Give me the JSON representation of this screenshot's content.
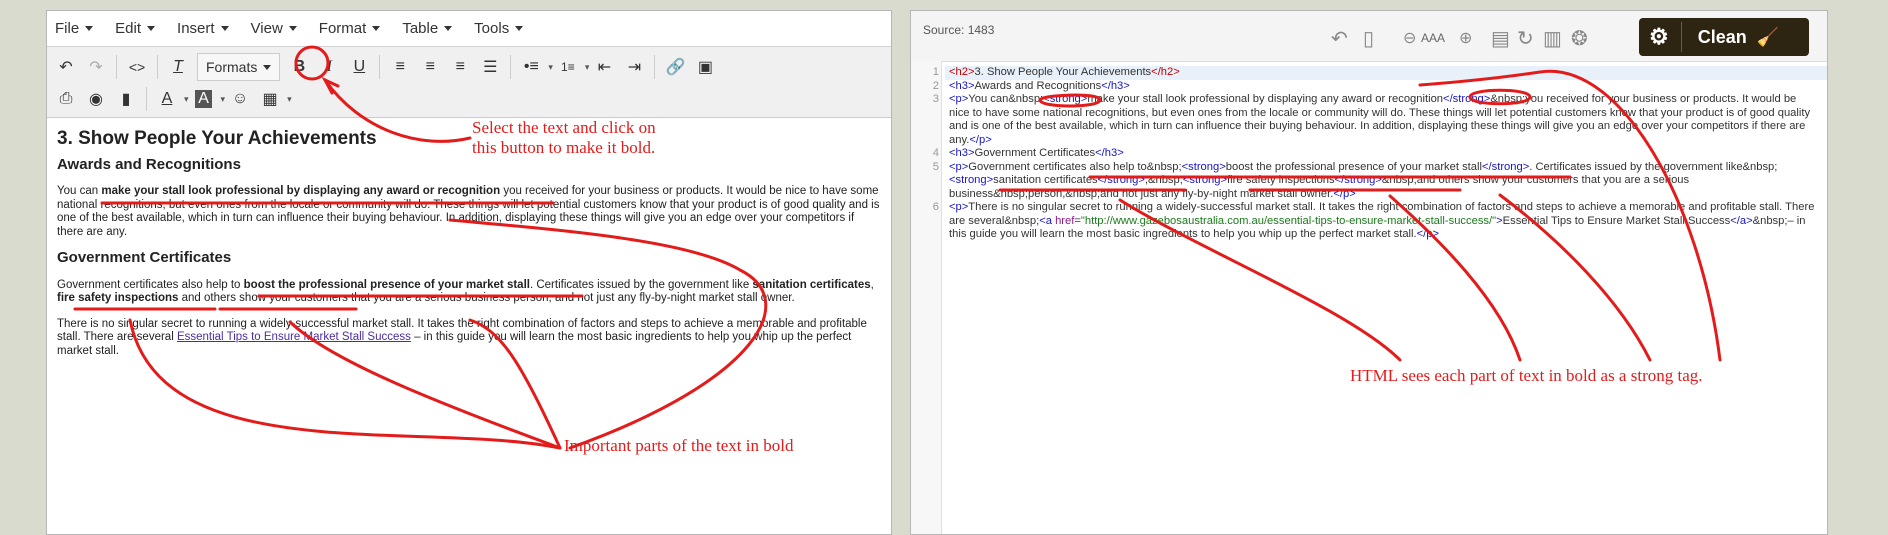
{
  "menubar": [
    "File",
    "Edit",
    "Insert",
    "View",
    "Format",
    "Table",
    "Tools"
  ],
  "toolbar": {
    "formats_label": "Formats"
  },
  "editor_content": {
    "h2": "3. Show People Your Achievements",
    "h3_awards": "Awards and Recognitions",
    "p1_pre": "You can ",
    "p1_bold": "make your stall look professional by displaying any award or recognition",
    "p1_post": " you received for your business or products. It would be nice to have some national recognitions, but even ones from the locale or community will do. These things will let potential customers know that your product is of good quality and is one of the best available, which in turn can influence their buying behaviour. In addition, displaying these things will give you an edge over your competitors if there are any.",
    "h3_gov": "Government Certificates",
    "p2_pre": "Government certificates also help to ",
    "p2_bold1": "boost the professional presence of your market stall",
    "p2_mid1": ". Certificates issued by the government like ",
    "p2_bold2": "sanitation certificates",
    "p2_mid2": ", ",
    "p2_bold3": "fire safety inspections",
    "p2_post": " and others show your customers that you are a serious business person, and not just any fly-by-night market stall owner.",
    "p3_pre": "There is no singular secret to running a widely-successful market stall. It takes the right combination of factors and steps to achieve a memorable and profitable stall. There are several ",
    "p3_link": "Essential Tips to Ensure Market Stall Success",
    "p3_post": " – in this guide you will learn the most basic ingredients to help you whip up the perfect market stall."
  },
  "source": {
    "label": "Source: 1483",
    "clean_label": "Clean",
    "zoom_label": "AAA",
    "line_numbers": [
      "1",
      "2",
      "3",
      "",
      "",
      "",
      "4",
      "5",
      "",
      "",
      "6",
      "",
      ""
    ],
    "l1_open": "<h2>",
    "l1_text": "3. Show People Your Achievements",
    "l1_close": "</h2>",
    "l2_open": "<h3>",
    "l2_text": "Awards and Recognitions",
    "l2_close": "</h3>",
    "l3_p": "<p>",
    "l3_a": "You can&nbsp;",
    "l3_s": "<strong>",
    "l3_b": "make your stall look professional by displaying any award or recognition",
    "l3_se": "</strong>",
    "l3_c": "&nbsp;you received for your business or products. It would be nice to have some national recognitions, but even ones from the locale or community will do. These things will let potential customers know that your product is of good quality and is one of the best available, which in turn can influence their buying behaviour. In addition, displaying these things will give you an edge over your competitors if there are any.",
    "l3_pe": "</p>",
    "l4_open": "<h3>",
    "l4_text": "Government Certificates",
    "l4_close": "</h3>",
    "l5_p": "<p>",
    "l5_a": "Government certificates also help to&nbsp;",
    "l5_s1": "<strong>",
    "l5_b1": "boost the professional presence of your market stall",
    "l5_se1": "</strong>",
    "l5_c": ". Certificates issued by the government like&nbsp;",
    "l5_s2": "<strong>",
    "l5_b2": "sanitation certificates",
    "l5_se2": "</strong>",
    "l5_d": ",&nbsp;",
    "l5_s3": "<strong>",
    "l5_b3": "fire safety inspections",
    "l5_se3": "</strong>",
    "l5_e": "&nbsp;and others show your customers that you are a serious business&nbsp;person,&nbsp;and not just any fly-by-night market stall owner.",
    "l5_pe": "</p>",
    "l6_p": "<p>",
    "l6_a": "There is no singular secret to running a widely-successful market stall. It takes the right combination of factors and steps to achieve a memorable and profitable stall. There are several&nbsp;",
    "l6_ao": "<a ",
    "l6_attr": "href",
    "l6_eq": "=",
    "l6_val": "\"http://www.gazebosaustralia.com.au/essential-tips-to-ensure-market-stall-success/\"",
    "l6_gt": ">",
    "l6_link": "Essential Tips to Ensure Market Stall Success",
    "l6_ac": "</a>",
    "l6_b": "&nbsp;– in this guide you will learn the most basic ingredients to help you whip up the perfect market stall.",
    "l6_pe": "</p>"
  },
  "annotations": {
    "bold_note_1": "Select the text and click on",
    "bold_note_2": "this button to make it bold.",
    "important_note": "Important parts of the text in bold",
    "html_note": "HTML sees each part of text in bold as a strong tag."
  },
  "colors": {
    "annotation": "#e31b1b",
    "tag": "#1515c8",
    "clean_button": "#2d2411"
  }
}
